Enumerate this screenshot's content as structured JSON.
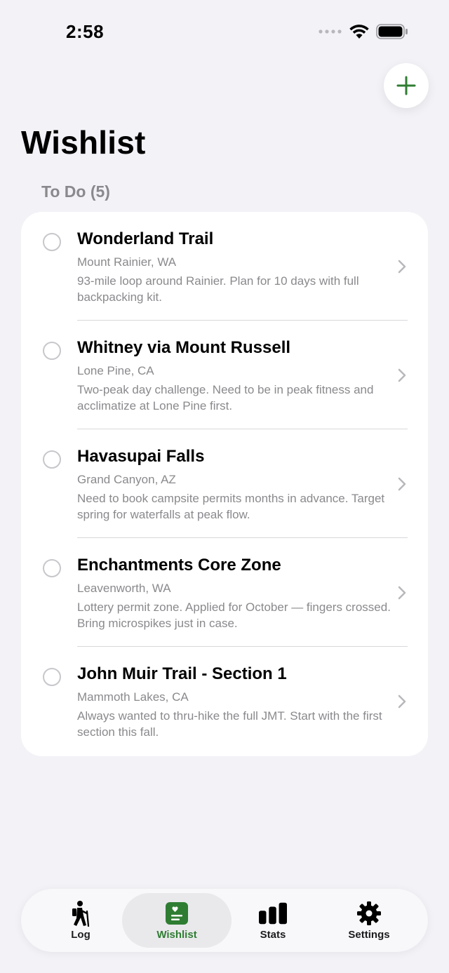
{
  "status_bar": {
    "time": "2:58"
  },
  "colors": {
    "accent": "#2f7d32",
    "background": "#f2f2f7",
    "secondary_text": "#8a8a8e"
  },
  "page": {
    "title": "Wishlist",
    "section_header": "To Do (5)",
    "add_icon": "plus-icon"
  },
  "items": [
    {
      "title": "Wonderland Trail",
      "location": "Mount Rainier, WA",
      "note": "93-mile loop around Rainier. Plan for 10 days with full backpacking kit."
    },
    {
      "title": "Whitney via Mount Russell",
      "location": "Lone Pine, CA",
      "note": "Two-peak day challenge. Need to be in peak fitness and acclimatize at Lone Pine first."
    },
    {
      "title": "Havasupai Falls",
      "location": "Grand Canyon, AZ",
      "note": "Need to book campsite permits months in advance. Target spring for waterfalls at peak flow."
    },
    {
      "title": "Enchantments Core Zone",
      "location": "Leavenworth, WA",
      "note": "Lottery permit zone. Applied for October — fingers crossed. Bring microspikes just in case."
    },
    {
      "title": "John Muir Trail - Section 1",
      "location": "Mammoth Lakes, CA",
      "note": "Always wanted to thru-hike the full JMT. Start with the first section this fall."
    }
  ],
  "tabs": [
    {
      "label": "Log",
      "icon": "hiker-icon"
    },
    {
      "label": "Wishlist",
      "icon": "wishlist-icon",
      "selected": true
    },
    {
      "label": "Stats",
      "icon": "bar-chart-icon"
    },
    {
      "label": "Settings",
      "icon": "gear-icon"
    }
  ]
}
